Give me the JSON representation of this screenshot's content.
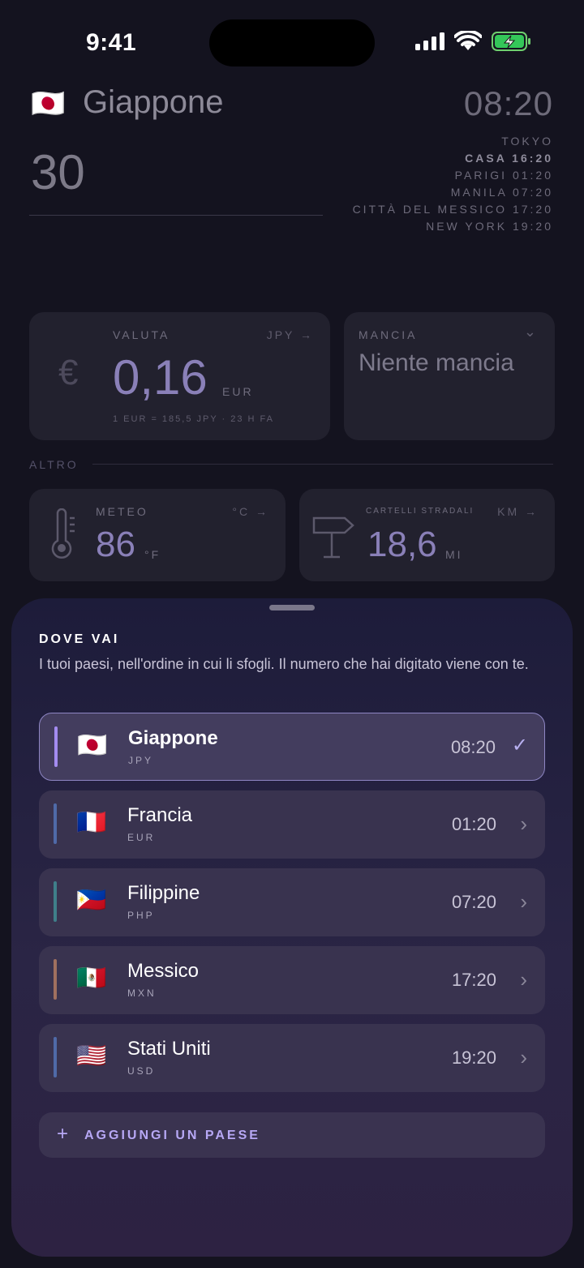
{
  "status_bar": {
    "time": "9:41"
  },
  "header": {
    "flag": "🇯🇵",
    "country": "Giappone",
    "amount": "30",
    "clock": "08:20",
    "location": "TOKYO",
    "timezones": [
      {
        "label": "CASA 16:20",
        "home": true
      },
      {
        "label": "PARIGI 01:20"
      },
      {
        "label": "MANILA 07:20"
      },
      {
        "label": "CITTÀ DEL MESSICO 17:20"
      },
      {
        "label": "NEW YORK 19:20"
      }
    ]
  },
  "currency_card": {
    "label": "VALUTA",
    "side": "JPY →",
    "symbol": "€",
    "value": "0,16",
    "unit": "EUR",
    "rate": "1 EUR = 185,5 JPY · 23 H FA"
  },
  "tip_card": {
    "label": "MANCIA",
    "value": "Niente mancia",
    "chevron": "⌄"
  },
  "section_label": "ALTRO",
  "weather_card": {
    "label": "METEO",
    "side": "°C →",
    "value": "86",
    "unit": "°F"
  },
  "signs_card": {
    "label": "CARTELLI STRADALI",
    "side": "KM →",
    "value": "18,6",
    "unit": "MI"
  },
  "sheet": {
    "title": "DOVE VAI",
    "description": "I tuoi paesi, nell'ordine in cui li sfogli. Il numero che hai digitato viene con te.",
    "countries": [
      {
        "flag": "🇯🇵",
        "name": "Giappone",
        "code": "JPY",
        "time": "08:20",
        "selected": true,
        "accent": "#a48cf0"
      },
      {
        "flag": "🇫🇷",
        "name": "Francia",
        "code": "EUR",
        "time": "01:20",
        "selected": false,
        "accent": "#4f6aa8"
      },
      {
        "flag": "🇵🇭",
        "name": "Filippine",
        "code": "PHP",
        "time": "07:20",
        "selected": false,
        "accent": "#3f7f8a"
      },
      {
        "flag": "🇲🇽",
        "name": "Messico",
        "code": "MXN",
        "time": "17:20",
        "selected": false,
        "accent": "#a0705f"
      },
      {
        "flag": "🇺🇸",
        "name": "Stati Uniti",
        "code": "USD",
        "time": "19:20",
        "selected": false,
        "accent": "#4f6aa8"
      }
    ],
    "add_label": "AGGIUNGI UN PAESE",
    "add_icon": "+"
  }
}
